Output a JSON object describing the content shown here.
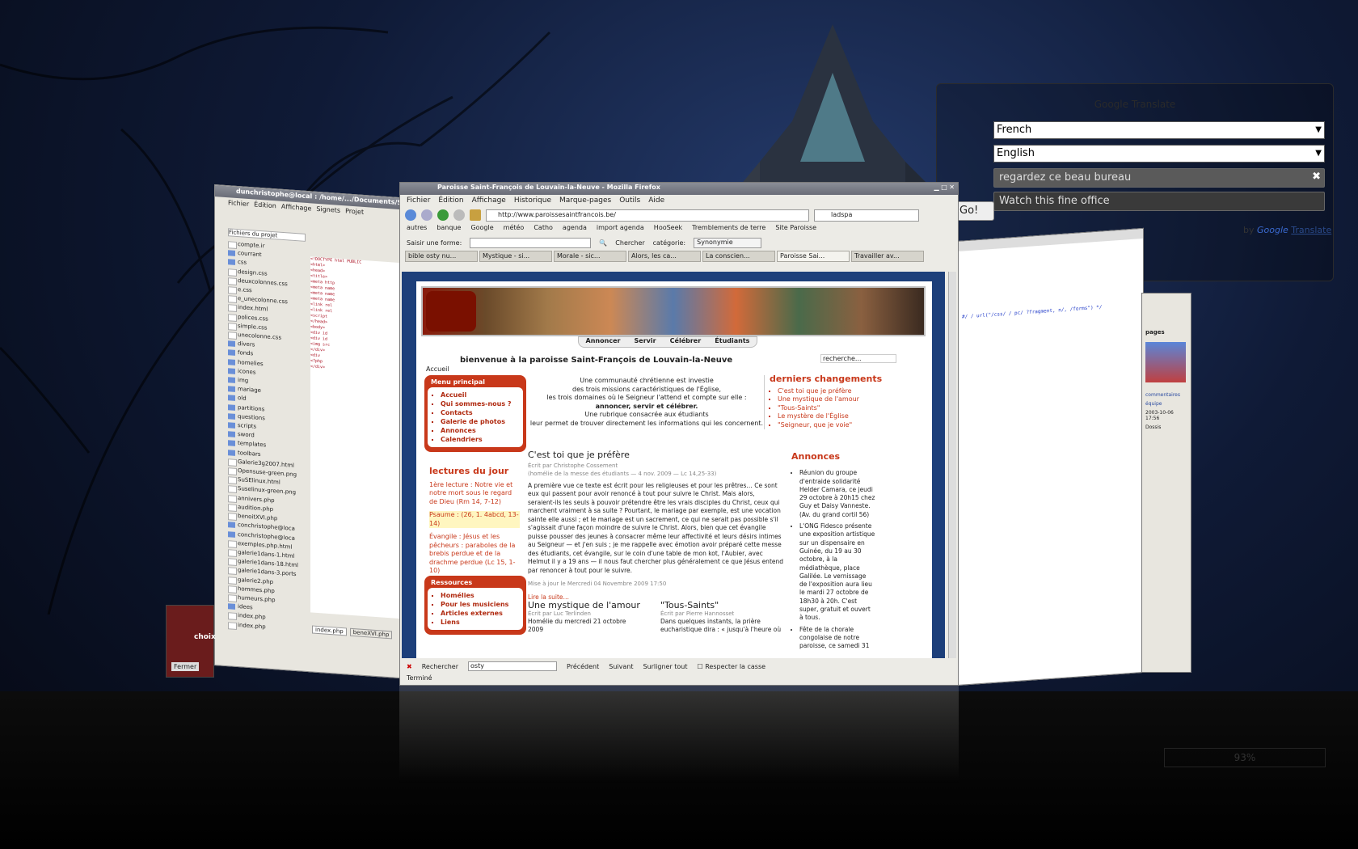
{
  "translator": {
    "title": "Google Translate",
    "from_lang": "French",
    "to_lang": "English",
    "input_text": "regardez ce beau bureau",
    "output_text": "Watch this fine office",
    "go_label": "Go!",
    "powered_by": "by",
    "google": "Google",
    "translate": "Translate"
  },
  "editor": {
    "title": "dunchristophe@local : /home/.../Documents/Site/index.php - Quanta",
    "menu": [
      "Fichier",
      "Édition",
      "Affichage",
      "Signets",
      "Projet"
    ],
    "panel_title": "Fichiers du projet",
    "files": [
      "compte.ir",
      "courrant",
      "css",
      "design.css",
      "deuxcolonnes.css",
      "e.css",
      "e_unecolonne.css",
      "index.html",
      "polices.css",
      "simple.css",
      "unecolonne.css",
      "divers",
      "fonds",
      "homelies",
      "icones",
      "img",
      "mariage",
      "old",
      "partitions",
      "questions",
      "scripts",
      "sword",
      "templates",
      "toolbars",
      "Galerie3g2007.html",
      "Opensuse-green.png",
      "SuSElinux.html",
      "Suselinux-green.png",
      "annivers.php",
      "audition.php",
      "benoitXVI.php",
      "conchristophe@loca",
      "conchristophe@loca",
      "exemples.php.html",
      "galerie1dans-1.html",
      "galerie1dans-18.html",
      "galerie1dans-3.ports",
      "galerie2.php",
      "hommes.php",
      "humeurs.php",
      "idees",
      "index.php",
      "index.php"
    ],
    "tabs": [
      "index.php",
      "beneXVI.php"
    ]
  },
  "small_window": {
    "label": "choix",
    "button": "Fermer"
  },
  "firefox": {
    "title": "Paroisse Saint-François de Louvain-la-Neuve - Mozilla Firefox",
    "menu": [
      "Fichier",
      "Édition",
      "Affichage",
      "Historique",
      "Marque-pages",
      "Outils",
      "Aide"
    ],
    "url": "http://www.paroissesaintfrancois.be/",
    "search_value": "ladspa",
    "bookmarks": [
      "autres",
      "banque",
      "Google",
      "météo",
      "Catho",
      "agenda",
      "import agenda",
      "HooSeek",
      "Tremblements de terre",
      "Site Paroisse"
    ],
    "toolbar3": {
      "form_label": "Saisir une forme:",
      "search_label": "Chercher",
      "category_label": "catégorie:",
      "category_value": "Synonymie"
    },
    "tabs": [
      "bible osty nu...",
      "Mystique - si...",
      "Morale - sic...",
      "Alors, les ca...",
      "La conscien...",
      "Paroisse Sai...",
      "Travailler av..."
    ],
    "find": {
      "label": "Rechercher",
      "value": "osty",
      "prev": "Précédent",
      "next": "Suivant",
      "highlight": "Surligner tout",
      "match_case": "Respecter la casse"
    },
    "status": "Terminé"
  },
  "site": {
    "nav": [
      "Annoncer",
      "Servir",
      "Célébrer",
      "Étudiants"
    ],
    "welcome": "bienvenue à la paroisse Saint-François de Louvain-la-Neuve",
    "breadcrumb": "Accueil",
    "search_placeholder": "recherche...",
    "menu_title": "Menu principal",
    "menu": [
      "Accueil",
      "Qui sommes-nous ?",
      "Contacts",
      "Galerie de photos",
      "Annonces",
      "Calendriers"
    ],
    "intro": [
      "Une communauté chrétienne est investie",
      "des trois missions caractéristiques de l'Église,",
      "les trois domaines où le Seigneur l'attend et compte sur elle :",
      "annoncer, servir et célébrer.",
      "Une rubrique consacrée aux étudiants",
      "leur permet de trouver directement les informations qui les concernent."
    ],
    "changes_title": "derniers changements",
    "changes": [
      "C'est toi que je préfère",
      "Une mystique de l'amour",
      "\"Tous-Saints\"",
      "Le mystère de l'Église",
      "\"Seigneur, que je voie\""
    ],
    "lectures_title": "lectures du jour",
    "lectures": [
      "1ère lecture : Notre vie et notre mort sous le regard de Dieu (Rm 14, 7-12)",
      "Psaume : (26, 1. 4abcd, 13-14)",
      "Évangile : Jésus et les pêcheurs : paraboles de la brebis perdue et de la drachme perdue (Lc 15, 1-10)"
    ],
    "resources_title": "Ressources",
    "resources": [
      "Homélies",
      "Pour les musiciens",
      "Articles externes",
      "Liens"
    ],
    "article": {
      "title": "C'est toi que je préfère",
      "author": "Écrit par Christophe Cossement",
      "subtitle": "(homélie de la messe des étudiants — 4 nov. 2009 — Lc 14,25-33)",
      "body": "A première vue ce texte est écrit pour les religieuses et pour les prêtres… Ce sont eux qui passent pour avoir renoncé à tout pour suivre le Christ. Mais alors, seraient-ils les seuls à pouvoir prétendre être les vrais disciples du Christ, ceux qui marchent vraiment à sa suite ? Pourtant, le mariage par exemple, est une vocation sainte elle aussi ; et le mariage est un sacrement, ce qui ne serait pas possible s'il s'agissait d'une façon moindre de suivre le Christ. Alors, bien que cet évangile puisse pousser des jeunes à consacrer même leur affectivité et leurs désirs intimes au Seigneur — et j'en suis ; je me rappelle avec émotion avoir préparé cette messe des étudiants, cet évangile, sur le coin d'une table de mon kot, l'Aubier, avec Helmut il y a 19 ans — il nous faut chercher plus généralement ce que Jésus entend par renoncer à tout pour le suivre.",
      "updated": "Mise à jour le Mercredi 04 Novembre 2009 17:50",
      "more": "Lire la suite…"
    },
    "annonces_title": "Annonces",
    "annonces": [
      "Réunion du groupe d'entraide solidarité Helder Camara, ce jeudi 29 octobre à 20h15 chez Guy et Daisy Vanneste. (Av. du grand cortil 56)",
      "L'ONG Fidesco présente une exposition artistique sur un dispensaire en Guinée, du 19 au 30 octobre, à la médiathèque, place Galilée. Le vernissage de l'exposition aura lieu le mardi 27 octobre de 18h30 à 20h. C'est super, gratuit et ouvert à tous.",
      "Fête de la chorale congolaise de notre paroisse, ce samedi 31"
    ],
    "article2": {
      "title": "Une mystique de l'amour",
      "author": "Écrit par Luc Terlinden",
      "body": "Homélie du mercredi 21 octobre 2009"
    },
    "article3": {
      "title": "\"Tous-Saints\"",
      "author": "Écrit par Pierre Hannosset",
      "body": "Dans quelques instants, la prière eucharistique dira : « jusqu'à l'heure où"
    }
  },
  "right_window": {
    "code": "#/ / url(\"/css/ / pc/   ?fragment, n/, /forms\") */",
    "tabs": [
      "pages",
      "commentaires",
      "équipe"
    ],
    "date": "2003-10-06 17:56",
    "user": "Dossis"
  },
  "volume": "93%"
}
